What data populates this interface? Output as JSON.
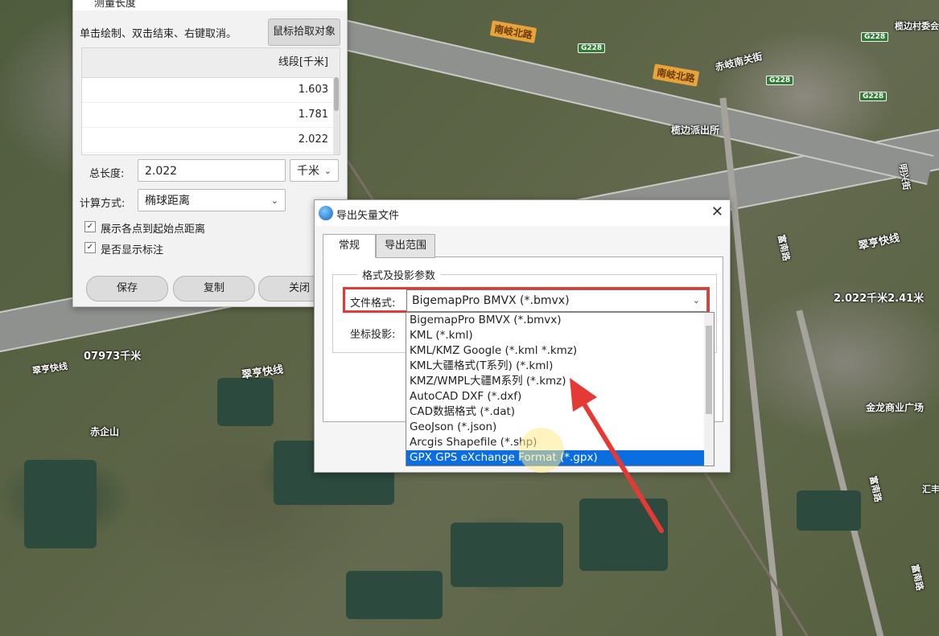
{
  "map": {
    "place_labels": [
      "南岐北路",
      "南岐北路",
      "赤岐南关街",
      "榄边村委会",
      "榄边派出所",
      "赤企山",
      "金龙商业广场",
      "翠亨快线",
      "翠亨快线",
      "翠亨快线"
    ],
    "shields": [
      "G228",
      "G228",
      "G228",
      "G228"
    ],
    "measure_labels": [
      "07973千米",
      "2.022千米2.41米"
    ],
    "side_labels": [
      "明兴街",
      "富南路",
      "富南路",
      "富南路",
      "汇丰"
    ]
  },
  "measure_panel": {
    "title": "测量长度",
    "hint": "单击绘制、双击结束、右键取消。",
    "pick_button": "鼠标拾取对象",
    "column_header": "线段[千米]",
    "segments": [
      "1.603",
      "1.781",
      "2.022"
    ],
    "total_label": "总长度:",
    "total_value": "2.022",
    "unit": "千米",
    "calc_label": "计算方式:",
    "calc_value": "椭球距离",
    "check1": "展示各点到起始点距离",
    "check2": "是否显示标注",
    "save": "保存",
    "copy": "复制",
    "close": "关闭"
  },
  "export_dialog": {
    "title": "导出矢量文件",
    "tab_general": "常规",
    "tab_range": "导出范围",
    "group_title": "格式及投影参数",
    "format_label": "文件格式:",
    "format_value": "BigemapPro BMVX (*.bmvx)",
    "projection_label": "坐标投影:",
    "options": [
      "BigemapPro BMVX (*.bmvx)",
      "KML (*.kml)",
      "KML/KMZ Google (*.kml *.kmz)",
      "KML大疆格式(T系列) (*.kml)",
      "KMZ/WMPL大疆M系列 (*.kmz)",
      "AutoCAD DXF (*.dxf)",
      "CAD数据格式 (*.dat)",
      "GeoJson (*.json)",
      "Arcgis Shapefile (*.shp)",
      "GPX GPS eXchange Format (*.gpx)"
    ],
    "selected_index": 9
  },
  "colors": {
    "highlight": "#0a6ee0",
    "annotation_red": "#e53935"
  }
}
